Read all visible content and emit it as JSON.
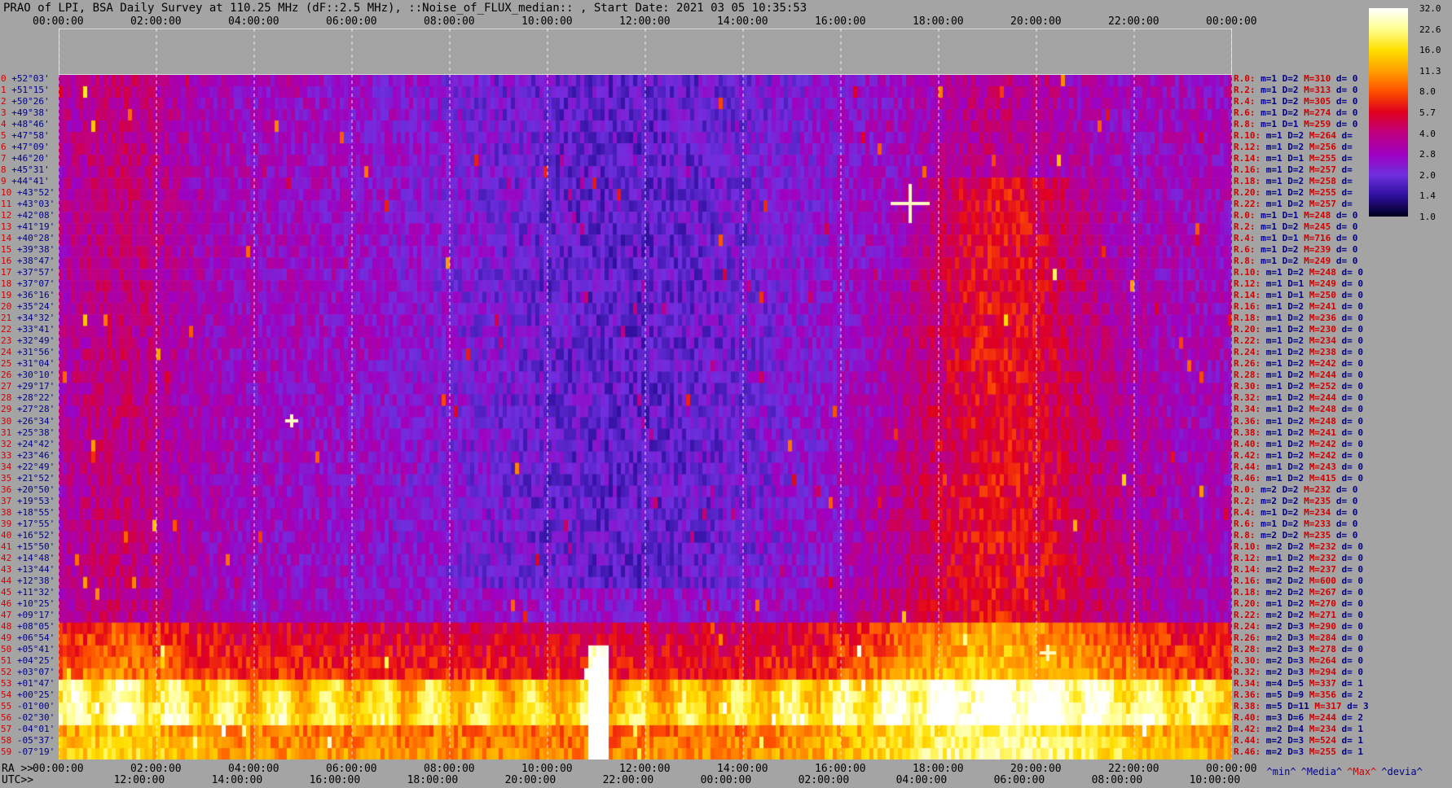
{
  "title": "PRAO of LPI, BSA Daily Survey at 110.25 MHz (dF::2.5 MHz), ::Noise_of_FLUX_median:: , Start Date: 2021 03 05 10:35:53",
  "top_time_labels": [
    "00:00:00",
    "02:00:00",
    "04:00:00",
    "06:00:00",
    "08:00:00",
    "10:00:00",
    "12:00:00",
    "14:00:00",
    "16:00:00",
    "18:00:00",
    "20:00:00",
    "22:00:00",
    "00:00:00"
  ],
  "ra_prefix": "RA >>",
  "ra_labels": [
    "00:00:00",
    "02:00:00",
    "04:00:00",
    "06:00:00",
    "08:00:00",
    "10:00:00",
    "12:00:00",
    "14:00:00",
    "16:00:00",
    "18:00:00",
    "20:00:00",
    "22:00:00",
    "00:00:00"
  ],
  "utc_prefix": "UTC>>",
  "utc_labels": [
    "12:00:00",
    "14:00:00",
    "16:00:00",
    "18:00:00",
    "20:00:00",
    "22:00:00",
    "00:00:00",
    "02:00:00",
    "04:00:00",
    "06:00:00",
    "08:00:00",
    "10:00:00"
  ],
  "colorbar": {
    "ticks": [
      "32.0",
      "22.6",
      "16.0",
      "11.3",
      "8.0",
      "5.7",
      "4.0",
      "2.8",
      "2.0",
      "1.4",
      "1.0"
    ],
    "colors": [
      "#ffffff",
      "#ffff90",
      "#ffe000",
      "#ffa000",
      "#ff5000",
      "#e00020",
      "#c00080",
      "#a000c0",
      "#7030e0",
      "#3010a0",
      "#000020"
    ]
  },
  "legend": {
    "min": "^min^",
    "median": "^Media^",
    "max": "^Max^",
    "dev": "^devia^",
    "min_color": "#00008a",
    "median_color": "#00008a",
    "max_color": "#d00000",
    "dev_color": "#00008a"
  },
  "chart_data": {
    "type": "heatmap",
    "title": "PRAO of LPI, BSA Daily Survey at 110.25 MHz (dF::2.5 MHz), ::Noise_of_FLUX_median:: , Start Date: 2021 03 05 10:35:53",
    "x_axis": "RA / UTC",
    "declinations": [
      "+52°03'",
      "+51°15'",
      "+50°26'",
      "+49°38'",
      "+48°46'",
      "+47°58'",
      "+47°09'",
      "+46°20'",
      "+45°31'",
      "+44°41'",
      "+43°52'",
      "+43°03'",
      "+42°08'",
      "+41°19'",
      "+40°28'",
      "+39°38'",
      "+38°47'",
      "+37°57'",
      "+37°07'",
      "+36°16'",
      "+35°24'",
      "+34°32'",
      "+33°41'",
      "+32°49'",
      "+31°56'",
      "+31°04'",
      "+30°10'",
      "+29°17'",
      "+28°22'",
      "+27°28'",
      "+26°34'",
      "+25°38'",
      "+24°42'",
      "+23°46'",
      "+22°49'",
      "+21°52'",
      "+20°50'",
      "+19°53'",
      "+18°55'",
      "+17°55'",
      "+16°52'",
      "+15°50'",
      "+14°48'",
      "+13°44'",
      "+12°38'",
      "+11°32'",
      "+10°25'",
      "+09°17'",
      "+08°05'",
      "+06°54'",
      "+05°41'",
      "+04°25'",
      "+03°07'",
      "+01°47'",
      "+00°25'",
      "-01°00'",
      "-02°30'",
      "-04°01'",
      "-05°37'",
      "-07°19'"
    ],
    "row_index": [
      "0",
      "1",
      "2",
      "3",
      "4",
      "5",
      "6",
      "7",
      "8",
      "9",
      "10",
      "11",
      "12",
      "13",
      "14",
      "15",
      "16",
      "17",
      "18",
      "19",
      "20",
      "21",
      "22",
      "23",
      "24",
      "25",
      "26",
      "27",
      "28",
      "29",
      "30",
      "31",
      "32",
      "33",
      "34",
      "35",
      "36",
      "37",
      "38",
      "39",
      "40",
      "41",
      "42",
      "43",
      "44",
      "45",
      "46",
      "47",
      "48",
      "49",
      "50",
      "51",
      "52",
      "53",
      "54",
      "55",
      "56",
      "57",
      "58",
      "59"
    ],
    "stats": [
      {
        "r": "R.0:",
        "m": "m=1",
        "D": "D=2",
        "M": "M=310",
        "d": "d= 0"
      },
      {
        "r": "R.2:",
        "m": "m=1",
        "D": "D=2",
        "M": "M=313",
        "d": "d= 0"
      },
      {
        "r": "R.4:",
        "m": "m=1",
        "D": "D=2",
        "M": "M=305",
        "d": "d= 0"
      },
      {
        "r": "R.6:",
        "m": "m=1",
        "D": "D=2",
        "M": "M=274",
        "d": "d= 0"
      },
      {
        "r": "R.8:",
        "m": "m=1",
        "D": "D=1",
        "M": "M=259",
        "d": "d= 0"
      },
      {
        "r": "R.10:",
        "m": "m=1",
        "D": "D=2",
        "M": "M=264",
        "d": "d="
      },
      {
        "r": "R.12:",
        "m": "m=1",
        "D": "D=2",
        "M": "M=256",
        "d": "d="
      },
      {
        "r": "R.14:",
        "m": "m=1",
        "D": "D=1",
        "M": "M=255",
        "d": "d="
      },
      {
        "r": "R.16:",
        "m": "m=1",
        "D": "D=2",
        "M": "M=257",
        "d": "d="
      },
      {
        "r": "R.18:",
        "m": "m=1",
        "D": "D=2",
        "M": "M=258",
        "d": "d="
      },
      {
        "r": "R.20:",
        "m": "m=1",
        "D": "D=2",
        "M": "M=255",
        "d": "d="
      },
      {
        "r": "R.22:",
        "m": "m=1",
        "D": "D=2",
        "M": "M=257",
        "d": "d="
      },
      {
        "r": "R.0:",
        "m": "m=1",
        "D": "D=1",
        "M": "M=248",
        "d": "d= 0"
      },
      {
        "r": "R.2:",
        "m": "m=1",
        "D": "D=2",
        "M": "M=245",
        "d": "d= 0"
      },
      {
        "r": "R.4:",
        "m": "m=1",
        "D": "D=1",
        "M": "M=716",
        "d": "d= 0"
      },
      {
        "r": "R.6:",
        "m": "m=1",
        "D": "D=2",
        "M": "M=239",
        "d": "d= 0"
      },
      {
        "r": "R.8:",
        "m": "m=1",
        "D": "D=2",
        "M": "M=249",
        "d": "d= 0"
      },
      {
        "r": "R.10:",
        "m": "m=1",
        "D": "D=2",
        "M": "M=248",
        "d": "d= 0"
      },
      {
        "r": "R.12:",
        "m": "m=1",
        "D": "D=1",
        "M": "M=249",
        "d": "d= 0"
      },
      {
        "r": "R.14:",
        "m": "m=1",
        "D": "D=1",
        "M": "M=250",
        "d": "d= 0"
      },
      {
        "r": "R.16:",
        "m": "m=1",
        "D": "D=2",
        "M": "M=241",
        "d": "d= 0"
      },
      {
        "r": "R.18:",
        "m": "m=1",
        "D": "D=2",
        "M": "M=236",
        "d": "d= 0"
      },
      {
        "r": "R.20:",
        "m": "m=1",
        "D": "D=2",
        "M": "M=230",
        "d": "d= 0"
      },
      {
        "r": "R.22:",
        "m": "m=1",
        "D": "D=2",
        "M": "M=234",
        "d": "d= 0"
      },
      {
        "r": "R.24:",
        "m": "m=1",
        "D": "D=2",
        "M": "M=238",
        "d": "d= 0"
      },
      {
        "r": "R.26:",
        "m": "m=1",
        "D": "D=2",
        "M": "M=242",
        "d": "d= 0"
      },
      {
        "r": "R.28:",
        "m": "m=1",
        "D": "D=2",
        "M": "M=244",
        "d": "d= 0"
      },
      {
        "r": "R.30:",
        "m": "m=1",
        "D": "D=2",
        "M": "M=252",
        "d": "d= 0"
      },
      {
        "r": "R.32:",
        "m": "m=1",
        "D": "D=2",
        "M": "M=244",
        "d": "d= 0"
      },
      {
        "r": "R.34:",
        "m": "m=1",
        "D": "D=2",
        "M": "M=248",
        "d": "d= 0"
      },
      {
        "r": "R.36:",
        "m": "m=1",
        "D": "D=2",
        "M": "M=248",
        "d": "d= 0"
      },
      {
        "r": "R.38:",
        "m": "m=1",
        "D": "D=2",
        "M": "M=241",
        "d": "d= 0"
      },
      {
        "r": "R.40:",
        "m": "m=1",
        "D": "D=2",
        "M": "M=242",
        "d": "d= 0"
      },
      {
        "r": "R.42:",
        "m": "m=1",
        "D": "D=2",
        "M": "M=242",
        "d": "d= 0"
      },
      {
        "r": "R.44:",
        "m": "m=1",
        "D": "D=2",
        "M": "M=243",
        "d": "d= 0"
      },
      {
        "r": "R.46:",
        "m": "m=1",
        "D": "D=2",
        "M": "M=415",
        "d": "d= 0"
      },
      {
        "r": "R.0:",
        "m": "m=2",
        "D": "D=2",
        "M": "M=232",
        "d": "d= 0"
      },
      {
        "r": "R.2:",
        "m": "m=2",
        "D": "D=2",
        "M": "M=235",
        "d": "d= 0"
      },
      {
        "r": "R.4:",
        "m": "m=1",
        "D": "D=2",
        "M": "M=234",
        "d": "d= 0"
      },
      {
        "r": "R.6:",
        "m": "m=1",
        "D": "D=2",
        "M": "M=233",
        "d": "d= 0"
      },
      {
        "r": "R.8:",
        "m": "m=2",
        "D": "D=2",
        "M": "M=235",
        "d": "d= 0"
      },
      {
        "r": "R.10:",
        "m": "m=2",
        "D": "D=2",
        "M": "M=232",
        "d": "d= 0"
      },
      {
        "r": "R.12:",
        "m": "m=1",
        "D": "D=2",
        "M": "M=232",
        "d": "d= 0"
      },
      {
        "r": "R.14:",
        "m": "m=2",
        "D": "D=2",
        "M": "M=237",
        "d": "d= 0"
      },
      {
        "r": "R.16:",
        "m": "m=2",
        "D": "D=2",
        "M": "M=600",
        "d": "d= 0"
      },
      {
        "r": "R.18:",
        "m": "m=2",
        "D": "D=2",
        "M": "M=267",
        "d": "d= 0"
      },
      {
        "r": "R.20:",
        "m": "m=1",
        "D": "D=2",
        "M": "M=270",
        "d": "d= 0"
      },
      {
        "r": "R.22:",
        "m": "m=2",
        "D": "D=2",
        "M": "M=271",
        "d": "d= 0"
      },
      {
        "r": "R.24:",
        "m": "m=2",
        "D": "D=3",
        "M": "M=290",
        "d": "d= 0"
      },
      {
        "r": "R.26:",
        "m": "m=2",
        "D": "D=3",
        "M": "M=284",
        "d": "d= 0"
      },
      {
        "r": "R.28:",
        "m": "m=2",
        "D": "D=3",
        "M": "M=278",
        "d": "d= 0"
      },
      {
        "r": "R.30:",
        "m": "m=2",
        "D": "D=3",
        "M": "M=264",
        "d": "d= 0"
      },
      {
        "r": "R.32:",
        "m": "m=2",
        "D": "D=3",
        "M": "M=294",
        "d": "d= 0"
      },
      {
        "r": "R.34:",
        "m": "m=4",
        "D": "D=5",
        "M": "M=337",
        "d": "d= 1"
      },
      {
        "r": "R.36:",
        "m": "m=5",
        "D": "D=9",
        "M": "M=356",
        "d": "d= 2"
      },
      {
        "r": "R.38:",
        "m": "m=5",
        "D": "D=11",
        "M": "M=317",
        "d": "d= 3"
      },
      {
        "r": "R.40:",
        "m": "m=3",
        "D": "D=6",
        "M": "M=244",
        "d": "d= 2"
      },
      {
        "r": "R.42:",
        "m": "m=2",
        "D": "D=4",
        "M": "M=234",
        "d": "d= 1"
      },
      {
        "r": "R.44:",
        "m": "m=2",
        "D": "D=3",
        "M": "M=524",
        "d": "d= 1"
      },
      {
        "r": "R.46:",
        "m": "m=2",
        "D": "D=3",
        "M": "M=255",
        "d": "d= 1"
      }
    ],
    "colorbar_range": [
      1.0,
      32.0
    ],
    "colorbar_scale": "log"
  }
}
